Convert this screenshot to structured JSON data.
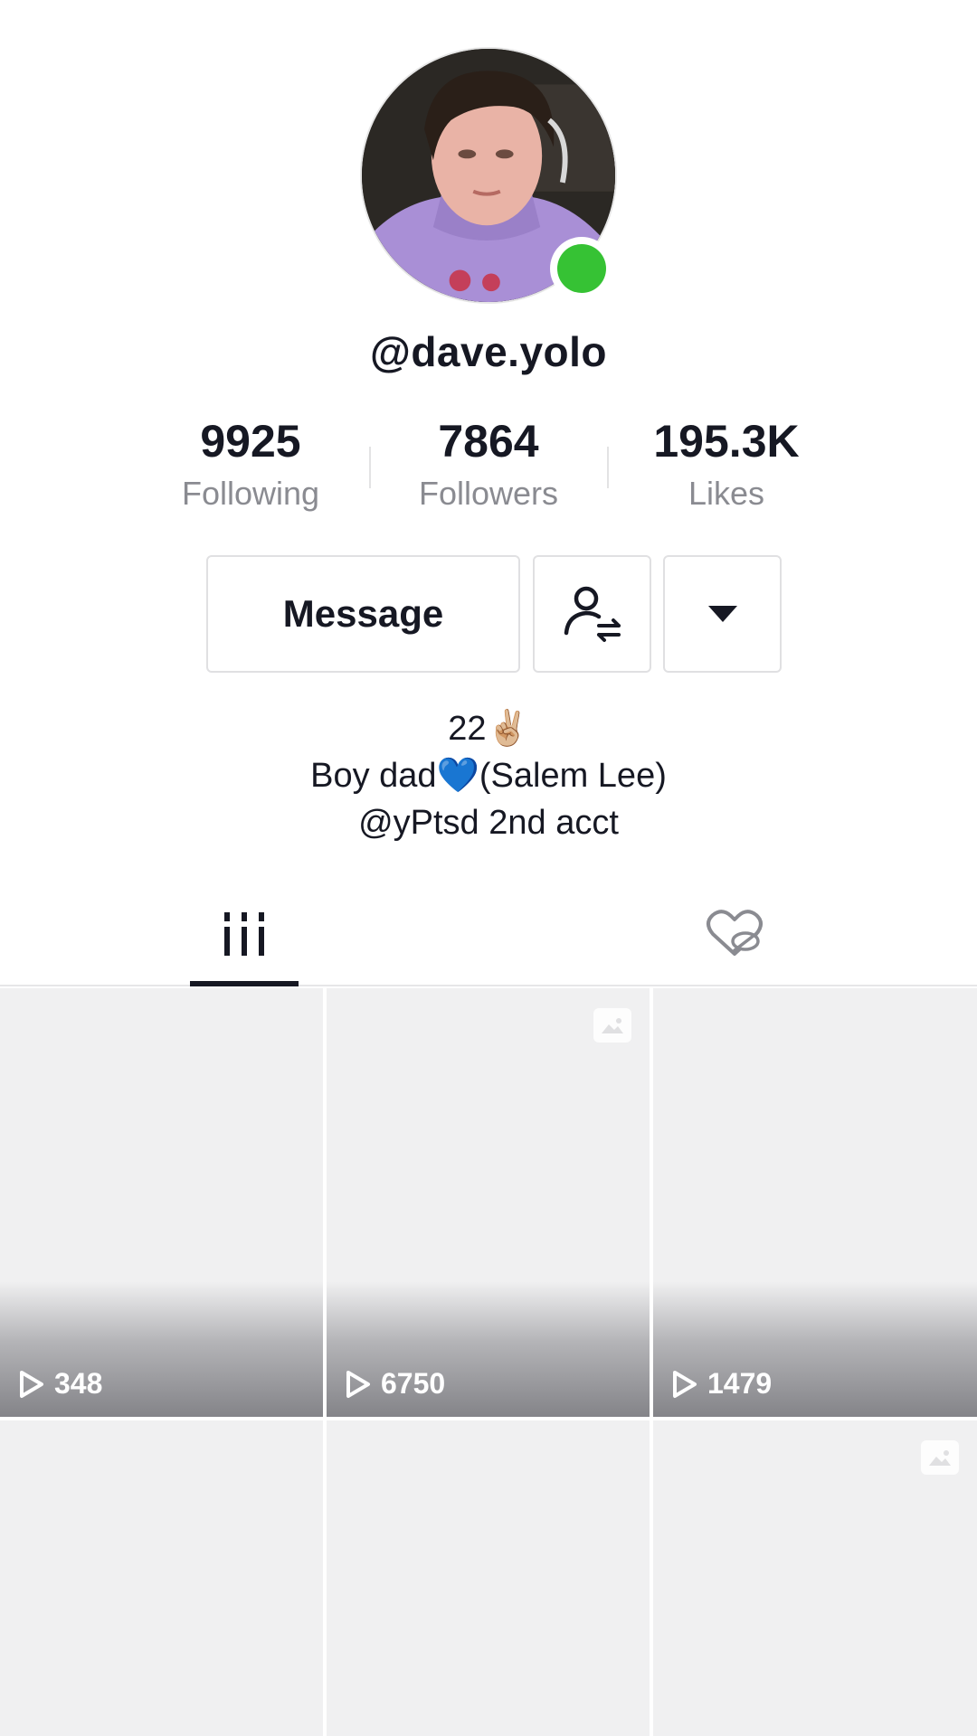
{
  "profile": {
    "username": "@dave.yolo",
    "online": true,
    "avatar_icon": "profile-photo"
  },
  "stats": {
    "following": {
      "value": "9925",
      "label": "Following"
    },
    "followers": {
      "value": "7864",
      "label": "Followers"
    },
    "likes": {
      "value": "195.3K",
      "label": "Likes"
    }
  },
  "actions": {
    "message_label": "Message",
    "follow_icon": "user-switch-icon",
    "more_icon": "caret-down-icon"
  },
  "bio": {
    "line1": "22✌🏼",
    "line2": "Boy dad💙(Salem Lee)",
    "line3": "@yPtsd 2nd acct"
  },
  "tabs": [
    {
      "name": "videos",
      "icon": "grid-bars-icon",
      "active": true
    },
    {
      "name": "liked",
      "icon": "hidden-heart-icon",
      "active": false
    }
  ],
  "videos": [
    {
      "views": "348",
      "photo": false
    },
    {
      "views": "6750",
      "photo": true
    },
    {
      "views": "1479",
      "photo": false
    },
    {
      "views": "",
      "photo": false
    },
    {
      "views": "",
      "photo": false
    },
    {
      "views": "",
      "photo": true
    }
  ],
  "colors": {
    "online": "#36c234",
    "text": "#161823",
    "muted": "#8a8b91",
    "tile": "#f0f0f1"
  }
}
